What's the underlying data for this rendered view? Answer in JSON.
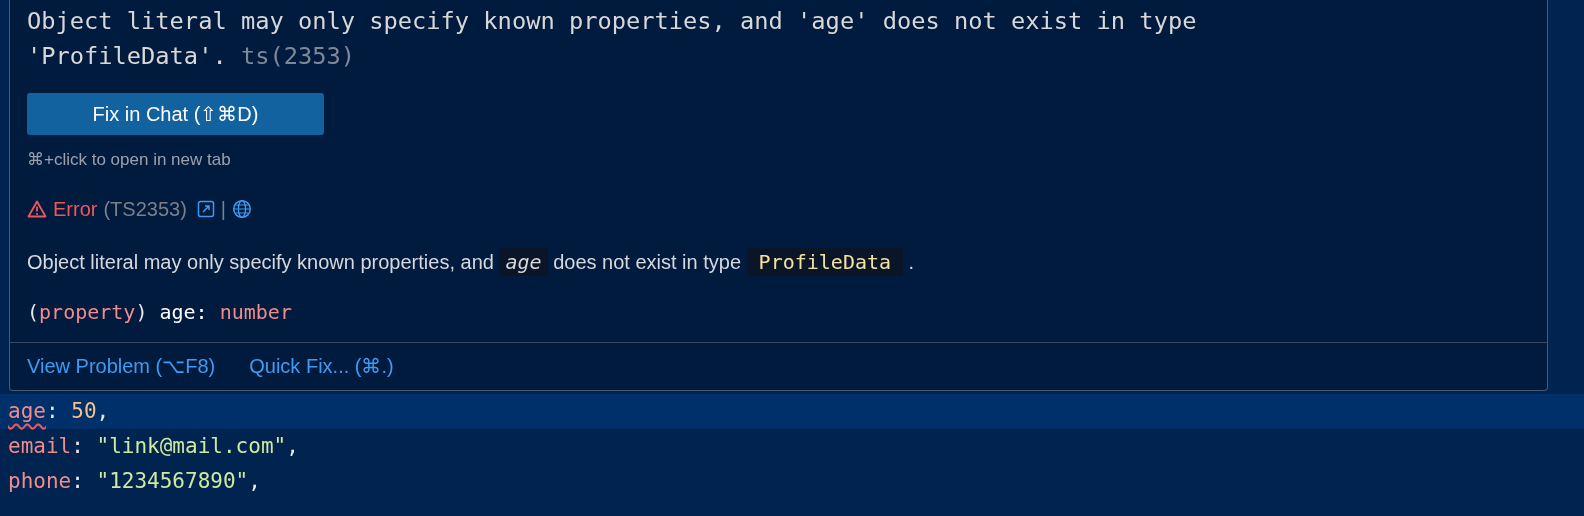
{
  "hover": {
    "message": {
      "text": "Object literal may only specify known properties, and 'age' does not exist in type 'ProfileData'.",
      "code": "ts(2353)"
    },
    "fix_button": "Fix in Chat (⇧⌘D)",
    "hint": "⌘+click to open in new tab",
    "error": {
      "label": "Error",
      "code": "(TS2353)",
      "separator": "|"
    },
    "description": [
      {
        "kind": "text",
        "text": "Object literal may only specify known properties, and"
      },
      {
        "kind": "code",
        "text": "age"
      },
      {
        "kind": "text",
        "text": "does not exist in type"
      },
      {
        "kind": "type",
        "text": "ProfileData"
      },
      {
        "kind": "text",
        "text": "."
      }
    ],
    "signature": [
      {
        "kind": "punct",
        "text": "("
      },
      {
        "kind": "keyword",
        "text": "property"
      },
      {
        "kind": "punct",
        "text": ") "
      },
      {
        "kind": "name",
        "text": "age: "
      },
      {
        "kind": "keyword",
        "text": "number"
      }
    ],
    "actions": [
      "View Problem (⌥F8)",
      "Quick Fix... (⌘.)"
    ]
  },
  "code_lines": [
    {
      "current": true,
      "tokens": [
        {
          "kind": "key",
          "text": "age",
          "error": true
        },
        {
          "kind": "punct",
          "text": ": "
        },
        {
          "kind": "number",
          "text": "50"
        },
        {
          "kind": "punct",
          "text": ","
        }
      ]
    },
    {
      "current": false,
      "tokens": [
        {
          "kind": "key",
          "text": "email"
        },
        {
          "kind": "punct",
          "text": ": "
        },
        {
          "kind": "string",
          "text": "\"link@mail.com\""
        },
        {
          "kind": "punct",
          "text": ","
        }
      ]
    },
    {
      "current": false,
      "tokens": [
        {
          "kind": "key",
          "text": "phone"
        },
        {
          "kind": "punct",
          "text": ": "
        },
        {
          "kind": "string",
          "text": "\"1234567890\""
        },
        {
          "kind": "punct",
          "text": ","
        }
      ]
    }
  ]
}
